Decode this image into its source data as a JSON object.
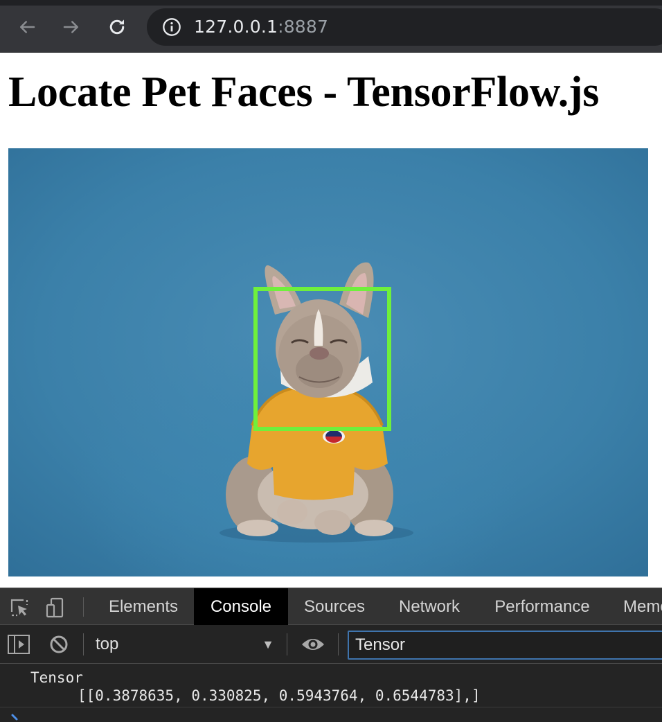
{
  "browser": {
    "url_host": "127.0.0.1",
    "url_port": ":8887",
    "icons": [
      "back-arrow-icon",
      "forward-arrow-icon",
      "reload-icon",
      "info-icon"
    ]
  },
  "page": {
    "title": "Locate Pet Faces - TensorFlow.js",
    "image": {
      "subject": "dog-photo",
      "box_color": "#6ff03c",
      "background_color": "#3a7fa7"
    }
  },
  "devtools": {
    "tabs": [
      "Elements",
      "Console",
      "Sources",
      "Network",
      "Performance",
      "Memo"
    ],
    "active_tab": "Console",
    "context": "top",
    "filter_value": "Tensor",
    "console_label": "Tensor",
    "console_value": "[[0.3878635, 0.330825, 0.5943764, 0.6544783],]",
    "icons": [
      "inspect-element-icon",
      "device-toolbar-icon",
      "sidebar-toggle-icon",
      "clear-console-icon",
      "dropdown-arrow-icon",
      "eye-icon",
      "prompt-chevron-icon"
    ]
  }
}
